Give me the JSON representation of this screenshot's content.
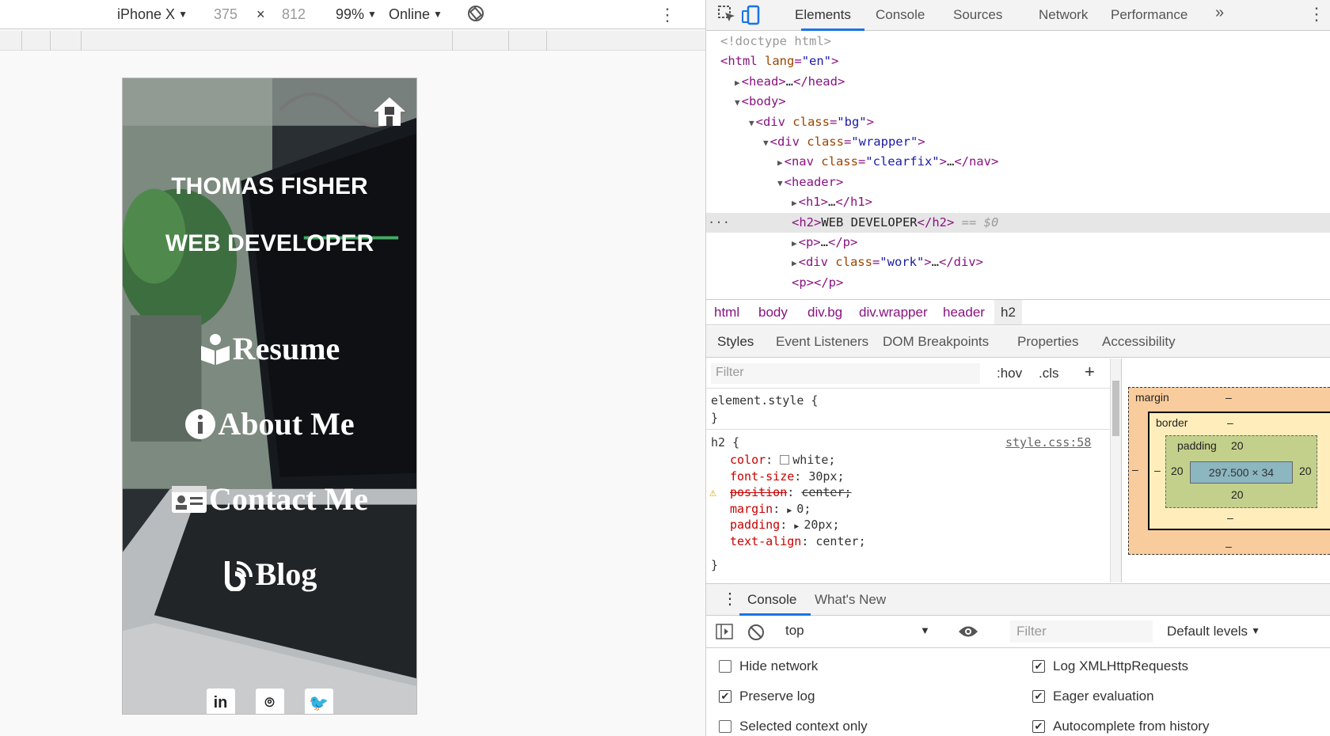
{
  "device_toolbar": {
    "device": "iPhone X",
    "width": "375",
    "times": "×",
    "height": "812",
    "zoom": "99%",
    "network": "Online",
    "more": "⋮"
  },
  "site": {
    "name": "THOMAS FISHER",
    "role": "WEB DEVELOPER",
    "nav": [
      "Resume",
      "About Me",
      "Contact Me",
      "Blog"
    ],
    "social": [
      "in",
      "⌾",
      "🐦"
    ]
  },
  "devtools": {
    "tabs": [
      "Elements",
      "Console",
      "Sources",
      "Network",
      "Performance"
    ],
    "more_tabs": "»",
    "dom_lines": [
      {
        "indent": 1,
        "html": "<!doctype html>",
        "kind": "gray"
      },
      {
        "indent": 1,
        "open": "html",
        "attrs": [
          [
            "lang",
            "\"en\""
          ]
        ]
      },
      {
        "indent": 2,
        "collapsed": "head"
      },
      {
        "indent": 2,
        "open": "body"
      },
      {
        "indent": 3,
        "open": "div",
        "attrs": [
          [
            "class",
            "\"bg\""
          ]
        ]
      },
      {
        "indent": 4,
        "open": "div",
        "attrs": [
          [
            "class",
            "\"wrapper\""
          ]
        ]
      },
      {
        "indent": 5,
        "collapsed": "nav",
        "attrs": [
          [
            "class",
            "\"clearfix\""
          ]
        ]
      },
      {
        "indent": 5,
        "open": "header"
      },
      {
        "indent": 6,
        "collapsed": "h1"
      },
      {
        "indent": 6,
        "text_el": "h2",
        "text": "WEB DEVELOPER",
        "marker": " == $0",
        "selected": true
      },
      {
        "indent": 6,
        "collapsed": "p"
      },
      {
        "indent": 6,
        "collapsed": "div",
        "attrs": [
          [
            "class",
            "\"work\""
          ]
        ]
      },
      {
        "indent": 6,
        "empty": "p"
      }
    ],
    "breadcrumbs": [
      "html",
      "body",
      "div.bg",
      "div.wrapper",
      "header",
      "h2"
    ],
    "sub_tabs": [
      "Styles",
      "Event Listeners",
      "DOM Breakpoints",
      "Properties",
      "Accessibility"
    ],
    "styles": {
      "filter_placeholder": "Filter",
      "hov": ":hov",
      "cls": ".cls",
      "plus": "+",
      "element_style": "element.style {",
      "close": "}",
      "rule_selector": "h2 {",
      "rule_source": "style.css:58",
      "props": [
        {
          "name": "color",
          "value": "white",
          "swatch": "#ffffff"
        },
        {
          "name": "font-size",
          "value": "30px"
        },
        {
          "name": "position",
          "value": "center",
          "invalid": true
        },
        {
          "name": "margin",
          "value": "0",
          "expand": true
        },
        {
          "name": "padding",
          "value": "20px",
          "expand": true
        },
        {
          "name": "text-align",
          "value": "center"
        }
      ]
    },
    "box_model": {
      "margin_label": "margin",
      "border_label": "border",
      "padding_label": "padding",
      "dash": "–",
      "padding_top": "20",
      "padding_left": "20",
      "padding_right": "20",
      "padding_bottom": "20",
      "content": "297.500 × 34"
    },
    "console_drawer": {
      "tabs": [
        "Console",
        "What's New"
      ],
      "context": "top",
      "filter_placeholder": "Filter",
      "levels": "Default levels",
      "options": [
        {
          "label": "Hide network",
          "checked": false
        },
        {
          "label": "Log XMLHttpRequests",
          "checked": true
        },
        {
          "label": "Preserve log",
          "checked": true
        },
        {
          "label": "Eager evaluation",
          "checked": true
        },
        {
          "label": "Selected context only",
          "checked": false
        },
        {
          "label": "Autocomplete from history",
          "checked": true
        }
      ]
    }
  }
}
